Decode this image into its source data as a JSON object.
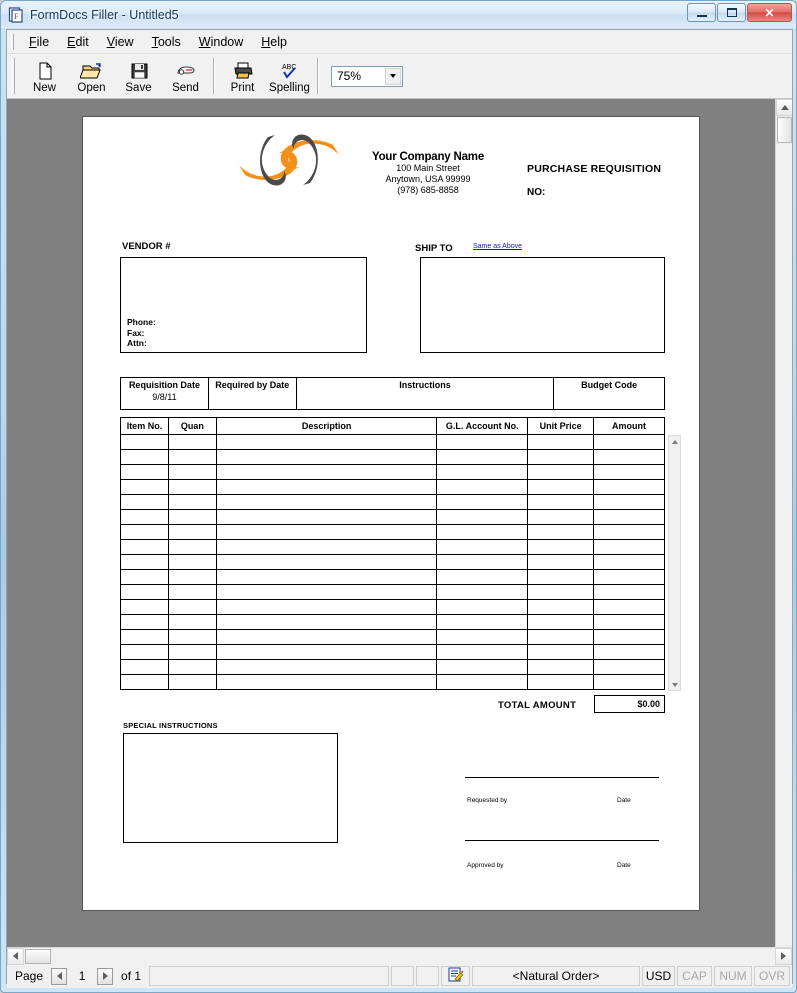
{
  "window": {
    "title": "FormDocs Filler - Untitled5",
    "icon": "app-form-icon",
    "buttons": {
      "minimize": "minimize",
      "maximize": "maximize",
      "close": "close"
    }
  },
  "menubar": {
    "items": [
      {
        "label": "File",
        "accel": "F"
      },
      {
        "label": "Edit",
        "accel": "E"
      },
      {
        "label": "View",
        "accel": "V"
      },
      {
        "label": "Tools",
        "accel": "T"
      },
      {
        "label": "Window",
        "accel": "W"
      },
      {
        "label": "Help",
        "accel": "H"
      }
    ]
  },
  "toolbar": {
    "buttons": [
      {
        "label": "New",
        "icon": "new-document-icon"
      },
      {
        "label": "Open",
        "icon": "open-folder-icon"
      },
      {
        "label": "Save",
        "icon": "floppy-disk-icon"
      },
      {
        "label": "Send",
        "icon": "send-mail-icon"
      },
      {
        "label": "Print",
        "icon": "printer-icon"
      },
      {
        "label": "Spelling",
        "icon": "spellcheck-abc-icon"
      }
    ],
    "zoom": {
      "value": "75%",
      "icon": "chevron-down-icon"
    }
  },
  "form": {
    "company": {
      "name": "Your Company Name",
      "address1": "100 Main Street",
      "address2": "Anytown, USA 99999",
      "phone": "(978) 685-8858"
    },
    "doc_title": "PURCHASE REQUISITION",
    "doc_number_label": "NO:",
    "vendor": {
      "label": "VENDOR #",
      "value": "",
      "phone_label": "Phone:",
      "fax_label": "Fax:",
      "attn_label": "Attn:"
    },
    "ship_to": {
      "label": "SHIP TO",
      "link": "Same as Above",
      "value": ""
    },
    "info_row": {
      "requisition_date_label": "Requisition Date",
      "requisition_date_value": "9/8/11",
      "required_by_label": "Required by Date",
      "required_by_value": "",
      "instructions_label": "Instructions",
      "instructions_value": "",
      "budget_code_label": "Budget Code",
      "budget_code_value": ""
    },
    "items_table": {
      "columns": [
        "Item No.",
        "Quan",
        "Description",
        "G.L. Account No.",
        "Unit Price",
        "Amount"
      ],
      "rows": [
        [
          "",
          "",
          "",
          "",
          "",
          ""
        ],
        [
          "",
          "",
          "",
          "",
          "",
          ""
        ],
        [
          "",
          "",
          "",
          "",
          "",
          ""
        ],
        [
          "",
          "",
          "",
          "",
          "",
          ""
        ],
        [
          "",
          "",
          "",
          "",
          "",
          ""
        ],
        [
          "",
          "",
          "",
          "",
          "",
          ""
        ],
        [
          "",
          "",
          "",
          "",
          "",
          ""
        ],
        [
          "",
          "",
          "",
          "",
          "",
          ""
        ],
        [
          "",
          "",
          "",
          "",
          "",
          ""
        ],
        [
          "",
          "",
          "",
          "",
          "",
          ""
        ],
        [
          "",
          "",
          "",
          "",
          "",
          ""
        ],
        [
          "",
          "",
          "",
          "",
          "",
          ""
        ],
        [
          "",
          "",
          "",
          "",
          "",
          ""
        ],
        [
          "",
          "",
          "",
          "",
          "",
          ""
        ],
        [
          "",
          "",
          "",
          "",
          "",
          ""
        ],
        [
          "",
          "",
          "",
          "",
          "",
          ""
        ],
        [
          "",
          "",
          "",
          "",
          "",
          ""
        ]
      ]
    },
    "total": {
      "label": "TOTAL AMOUNT",
      "value": "$0.00"
    },
    "special_instructions": {
      "label": "SPECIAL INSTRUCTIONS",
      "value": ""
    },
    "signatures": {
      "requested_by": "Requested by",
      "requested_date": "Date",
      "approved_by": "Approved by",
      "approved_date": "Date"
    }
  },
  "statusbar": {
    "page_label": "Page",
    "page_value": "1",
    "page_of": "of 1",
    "message": "",
    "mode_icon": "form-edit-icon",
    "order": "<Natural Order>",
    "currency": "USD",
    "cap": "CAP",
    "num": "NUM",
    "ovr": "OVR"
  },
  "colors": {
    "logo_orange": "#f39019",
    "logo_gray": "#4a4a4a",
    "link_blue": "#1414c8",
    "doc_background": "#808080"
  }
}
